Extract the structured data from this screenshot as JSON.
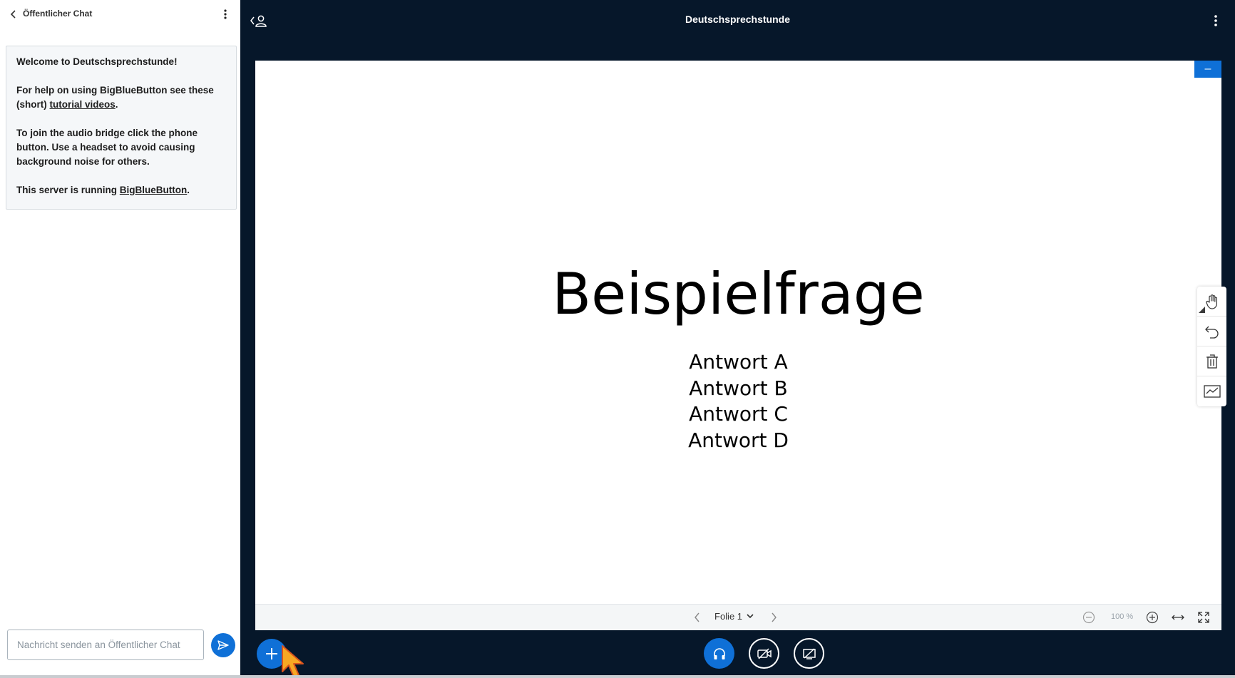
{
  "chat": {
    "title": "Öffentlicher Chat",
    "welcome": {
      "line1_prefix": "Welcome to ",
      "line1_meeting": "Deutschsprechstunde",
      "line1_suffix": "!",
      "help_prefix": "For help on using BigBlueButton see these (short) ",
      "help_link": "tutorial videos",
      "help_suffix": ".",
      "audio_text": "To join the audio bridge click the phone button. Use a headset to avoid causing background noise for others.",
      "server_prefix": "This server is running ",
      "server_link": "BigBlueButton",
      "server_suffix": "."
    },
    "input_placeholder": "Nachricht senden an Öffentlicher Chat"
  },
  "meeting": {
    "title": "Deutschsprechstunde"
  },
  "slide": {
    "title": "Beispielfrage",
    "answers": [
      "Antwort A",
      "Antwort B",
      "Antwort C",
      "Antwort D"
    ],
    "minimize_label": "–"
  },
  "presentation_nav": {
    "slide_label": "Folie 1",
    "zoom_level": "100 %"
  },
  "colors": {
    "accent": "#0f70d7",
    "dark_bg": "#06172a"
  }
}
